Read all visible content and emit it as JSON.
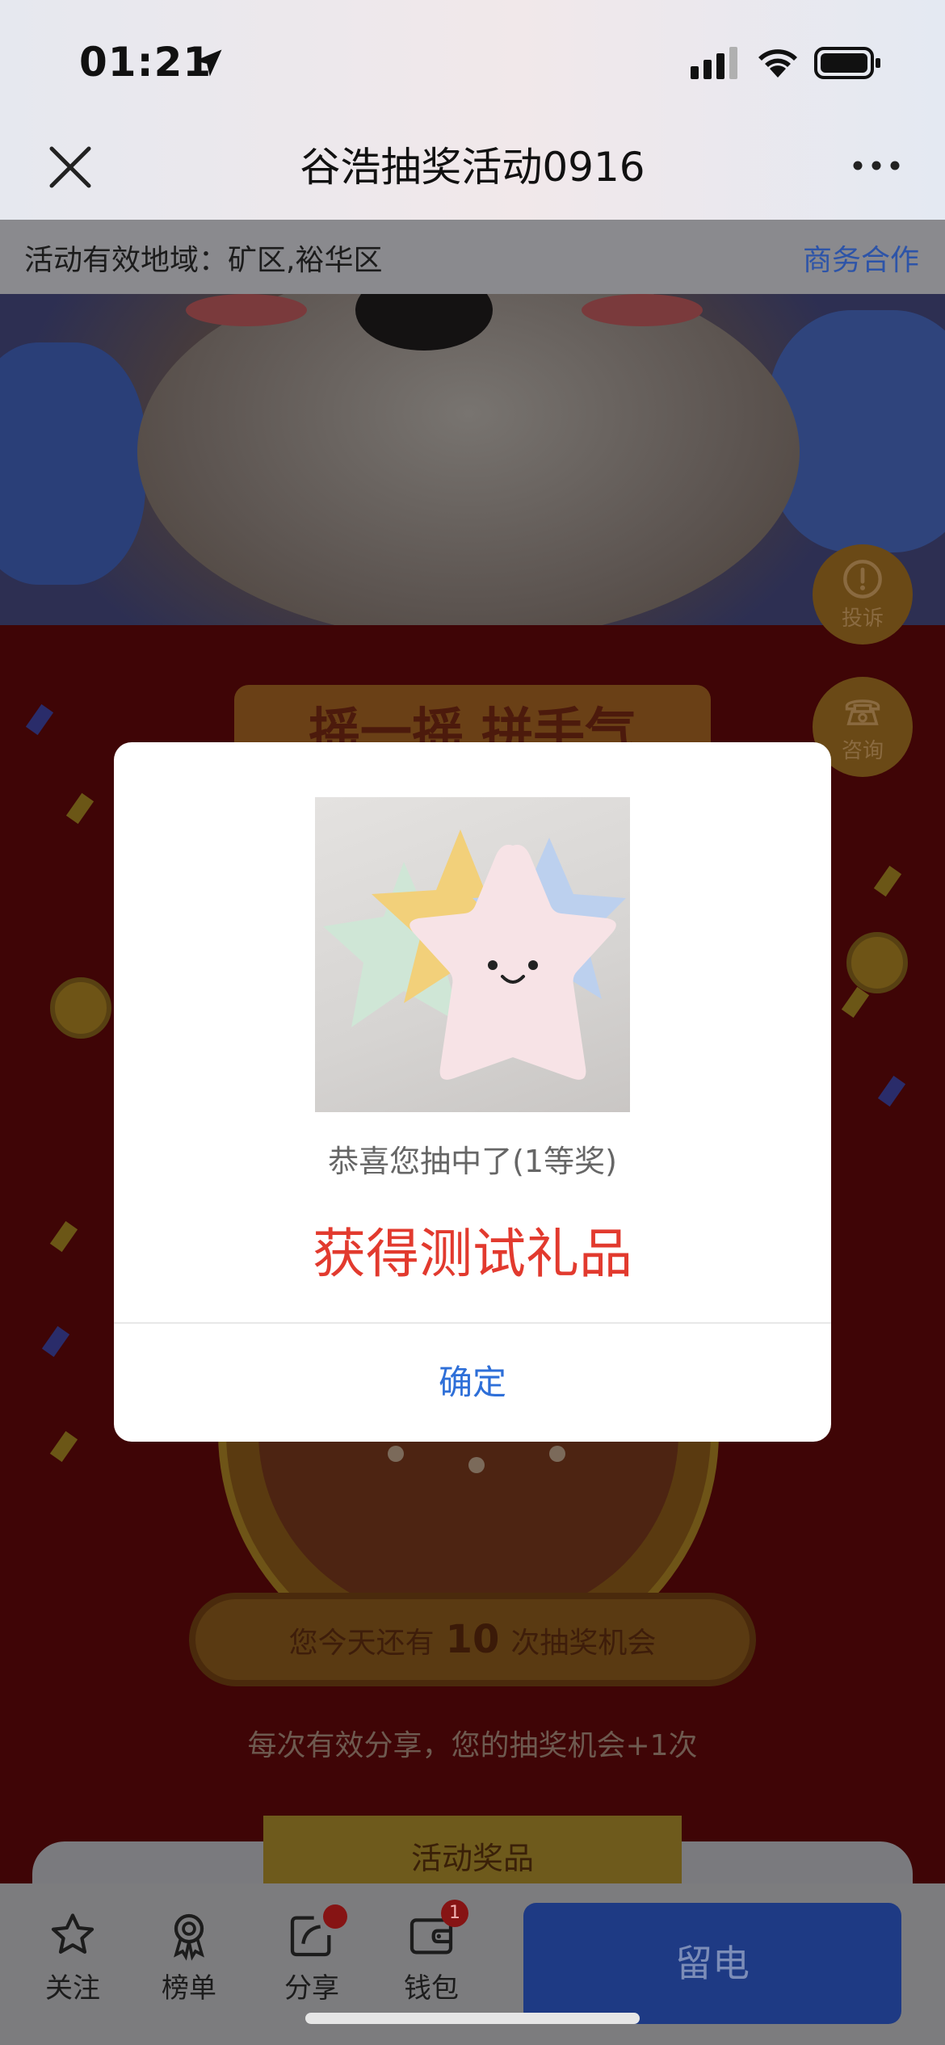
{
  "status_bar": {
    "time": "01:21"
  },
  "header": {
    "title": "谷浩抽奖活动0916",
    "close_icon": "close-icon",
    "more_icon": "more-horizontal-icon"
  },
  "region_bar": {
    "region_text": "活动有效地域：矿区,裕华区",
    "business_link": "商务合作"
  },
  "lottery": {
    "banner_text": "摇一摇 拼手气",
    "chance_prefix": "您今天还有",
    "chance_count": "10",
    "chance_suffix": "次抽奖机会",
    "share_tip": "每次有效分享，您的抽奖机会+1次",
    "prize_section_title": "活动奖品"
  },
  "float_buttons": {
    "complain_label": "投诉",
    "consult_label": "咨询"
  },
  "modal": {
    "subtitle": "恭喜您抽中了(1等奖)",
    "prize_name": "获得测试礼品",
    "confirm_label": "确定"
  },
  "tab_bar": {
    "items": [
      {
        "label": "关注",
        "icon": "star-icon"
      },
      {
        "label": "榜单",
        "icon": "ribbon-icon"
      },
      {
        "label": "分享",
        "icon": "share-icon"
      },
      {
        "label": "钱包",
        "icon": "wallet-icon",
        "badge": "1"
      }
    ],
    "cta_label": "留电"
  },
  "colors": {
    "prize_text": "#e23a2e",
    "confirm_text": "#2e6fd8",
    "cta_background": "#1e3a84"
  }
}
